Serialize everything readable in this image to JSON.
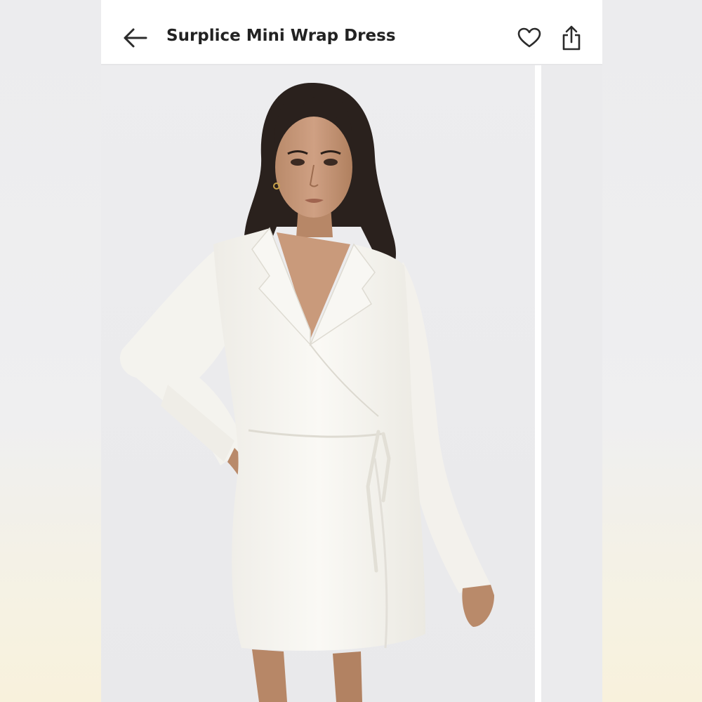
{
  "header": {
    "title": "Surplice Mini Wrap Dress",
    "back_icon": "arrow-left-icon",
    "like_icon": "heart-outline-icon",
    "share_icon": "share-icon"
  },
  "gallery": {
    "current_image": "model-white-wrap-dress-photo",
    "next_image": "next-product-photo-peek"
  },
  "colors": {
    "header_bg": "#ffffff",
    "title_text": "#222222",
    "photo_bg": "#ececee",
    "dress": "#f7f6f1"
  }
}
